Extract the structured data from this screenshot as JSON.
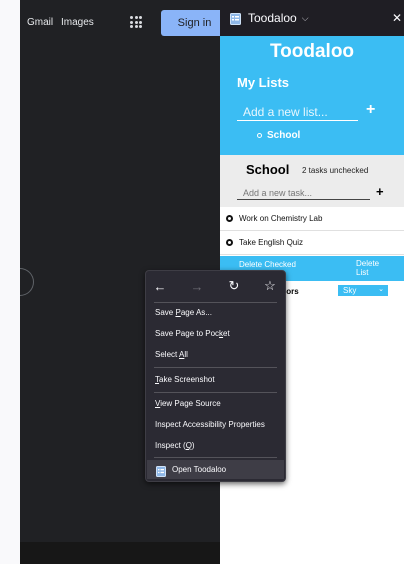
{
  "google": {
    "links": [
      "Gmail",
      "Images"
    ],
    "signin_label": "Sign in",
    "apps_icon": "apps-grid-icon"
  },
  "sidebar": {
    "header_title": "Toodaloo",
    "header_chevron": "⌵",
    "close_glyph": "✕"
  },
  "app": {
    "title": "Toodaloo",
    "my_lists_heading": "My Lists",
    "new_list_placeholder": "Add a new list...",
    "add_list_glyph": "+",
    "lists": [
      {
        "name": "School"
      }
    ],
    "current_list": {
      "name": "School",
      "status": "2 tasks unchecked",
      "new_task_placeholder": "Add a new task...",
      "add_task_glyph": "+",
      "tasks": [
        {
          "text": "Work on Chemistry Lab",
          "checked": false
        },
        {
          "text": "Take English Quiz",
          "checked": false
        }
      ]
    },
    "delete_checked_label": "Delete Checked",
    "delete_list_label": "Delete List",
    "colors_label": "lors",
    "colors_value": "Sky",
    "colors_arrow": "⌄",
    "accent_color": "#3bbdf3"
  },
  "context_menu": {
    "nav": {
      "back": "←",
      "forward": "→",
      "reload": "↻",
      "bookmark": "☆"
    },
    "items": {
      "save_page": {
        "pre": "Save ",
        "key": "P",
        "post": "age As..."
      },
      "save_pocket": {
        "pre": "Save Page to Poc",
        "key": "k",
        "post": "et"
      },
      "select_all": {
        "pre": "Select ",
        "key": "A",
        "post": "ll"
      },
      "screenshot": {
        "pre": "",
        "key": "T",
        "post": "ake Screenshot"
      },
      "view_source": {
        "pre": "",
        "key": "V",
        "post": "iew Page Source"
      },
      "accessibility": {
        "label": "Inspect Accessibility Properties"
      },
      "inspect": {
        "pre": "Inspect (",
        "key": "Q",
        "post": ")"
      },
      "open_toodaloo": {
        "label": "Open Toodaloo"
      }
    }
  }
}
